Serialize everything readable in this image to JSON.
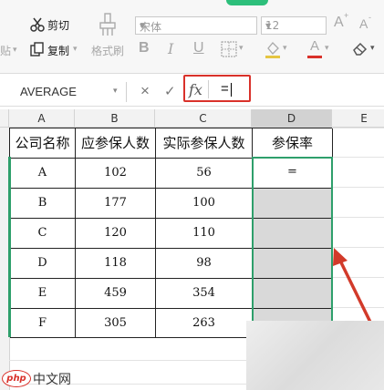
{
  "ribbon": {
    "cut_label": "剪切",
    "copy_label": "复制",
    "paste_partial": "贴",
    "format_painter_label": "格式刷",
    "font_name": "宋体",
    "font_size": "12",
    "bold": "B",
    "italic": "I",
    "underline": "U",
    "font_grow": "A",
    "font_shrink": "A",
    "font_color": "A"
  },
  "formula_bar": {
    "name_box": "AVERAGE",
    "cancel_icon": "×",
    "confirm_icon": "✓",
    "fx_label": "fx",
    "formula_value": "="
  },
  "columns": [
    "A",
    "B",
    "C",
    "D",
    "E"
  ],
  "table": {
    "headers": [
      "公司名称",
      "应参保人数",
      "实际参保人数",
      "参保率"
    ],
    "rows": [
      [
        "A",
        "102",
        "56",
        "="
      ],
      [
        "B",
        "177",
        "100",
        ""
      ],
      [
        "C",
        "120",
        "110",
        ""
      ],
      [
        "D",
        "118",
        "98",
        ""
      ],
      [
        "E",
        "459",
        "354",
        ""
      ],
      [
        "F",
        "305",
        "263",
        ""
      ]
    ]
  },
  "watermark": "中文网",
  "colors": {
    "highlight_box": "#d9312a",
    "selection_border": "#2e9f6b",
    "selection_fill": "#d9d9d9",
    "arrow": "#d23a2a"
  }
}
